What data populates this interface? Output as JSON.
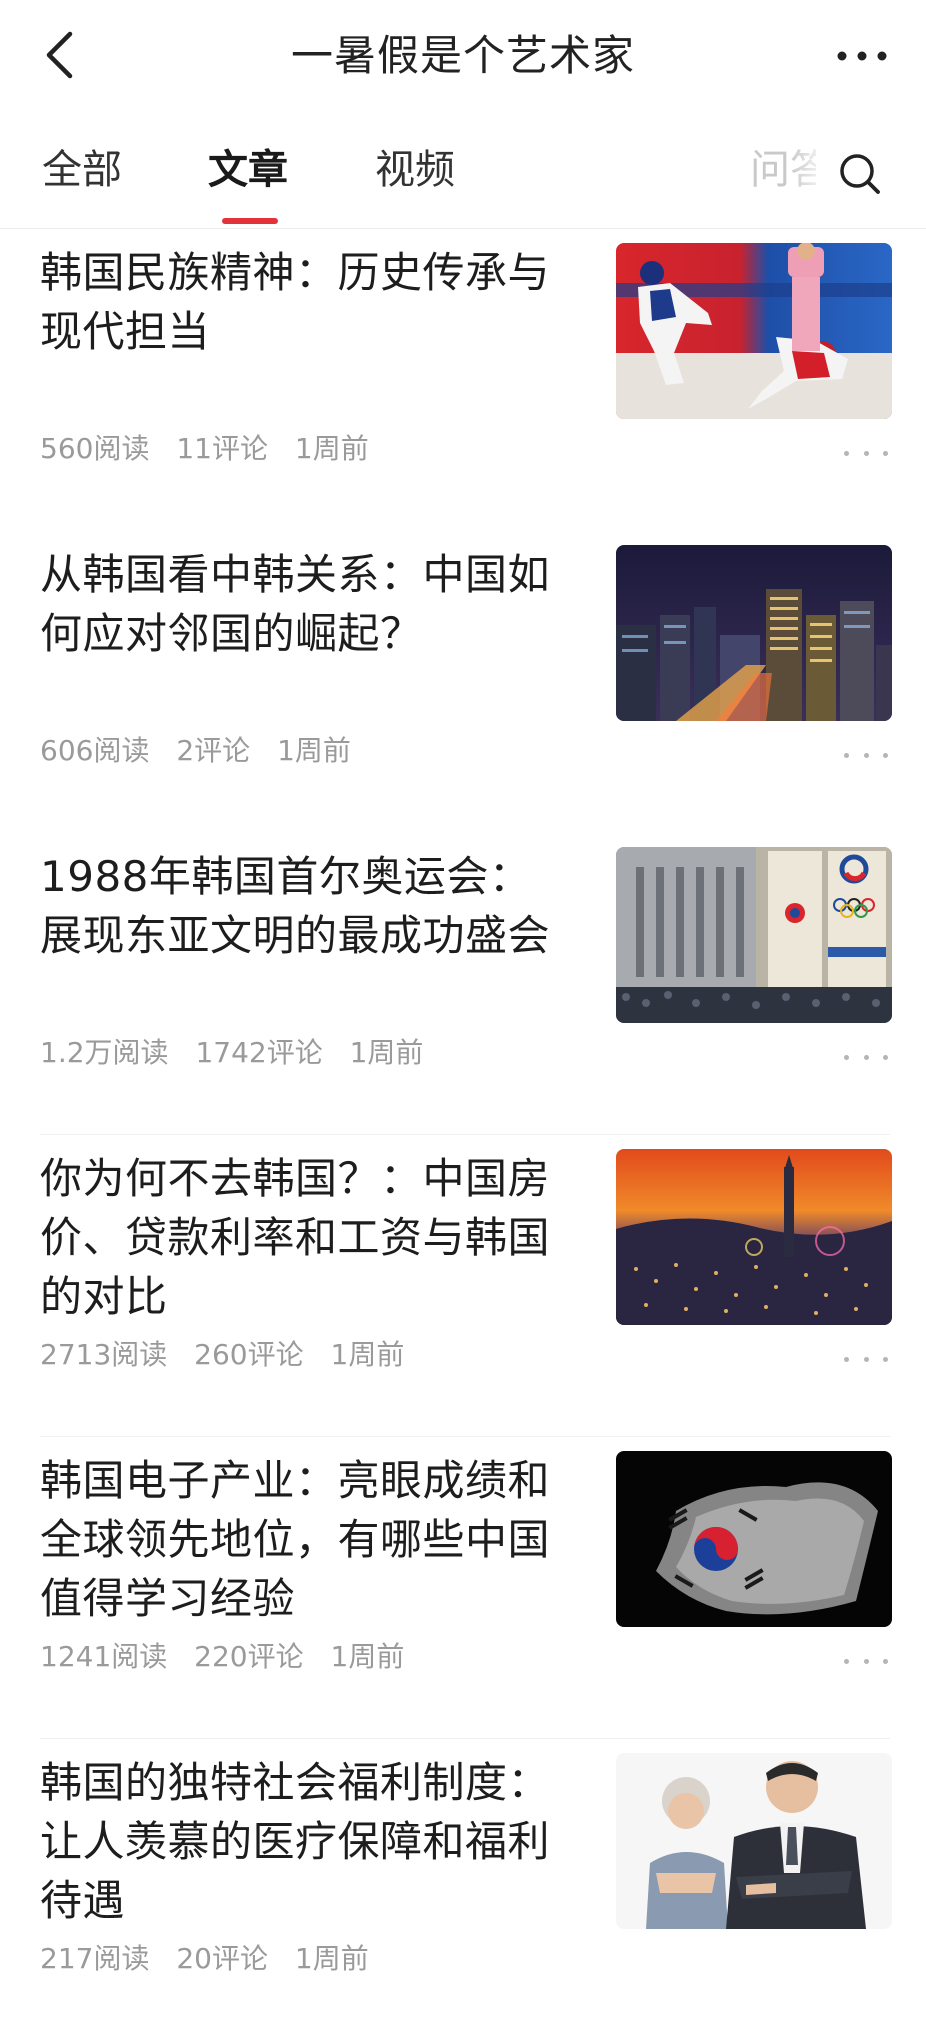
{
  "header": {
    "title": "一暑假是个艺术家"
  },
  "tabs": [
    {
      "label": "全部"
    },
    {
      "label": "文章"
    },
    {
      "label": "视频"
    },
    {
      "label": "问答"
    }
  ],
  "articles": [
    {
      "title": "韩国民族精神：历史传承与现代担当",
      "reads": "560阅读",
      "comments": "11评论",
      "time": "1周前",
      "image": "taekwondo-match"
    },
    {
      "title": "从韩国看中韩关系：中国如何应对邻国的崛起？",
      "reads": "606阅读",
      "comments": "2评论",
      "time": "1周前",
      "image": "seoul-night-skyline"
    },
    {
      "title": "1988年韩国首尔奥运会：展现东亚文明的最成功盛会",
      "reads": "1.2万阅读",
      "comments": "1742评论",
      "time": "1周前",
      "image": "seoul-olympics-banner"
    },
    {
      "title": "你为何不去韩国？：中国房价、贷款利率和工资与韩国的对比",
      "reads": "2713阅读",
      "comments": "260评论",
      "time": "1周前",
      "image": "seoul-sunset-tower"
    },
    {
      "title": "韩国电子产业：亮眼成绩和全球领先地位，有哪些中国值得学习经验",
      "reads": "1241阅读",
      "comments": "220评论",
      "time": "1周前",
      "image": "korean-flag-particles"
    },
    {
      "title": "韩国的独特社会福利制度：让人羡慕的医疗保障和福利待遇",
      "reads": "217阅读",
      "comments": "20评论",
      "time": "1周前",
      "image": "elderly-couple"
    }
  ],
  "colors": {
    "accent": "#e2333b",
    "meta": "#9a9a9a",
    "divider": "#f0f0f0"
  },
  "icons": [
    "back-arrow-icon",
    "more-dots-icon",
    "search-icon"
  ]
}
